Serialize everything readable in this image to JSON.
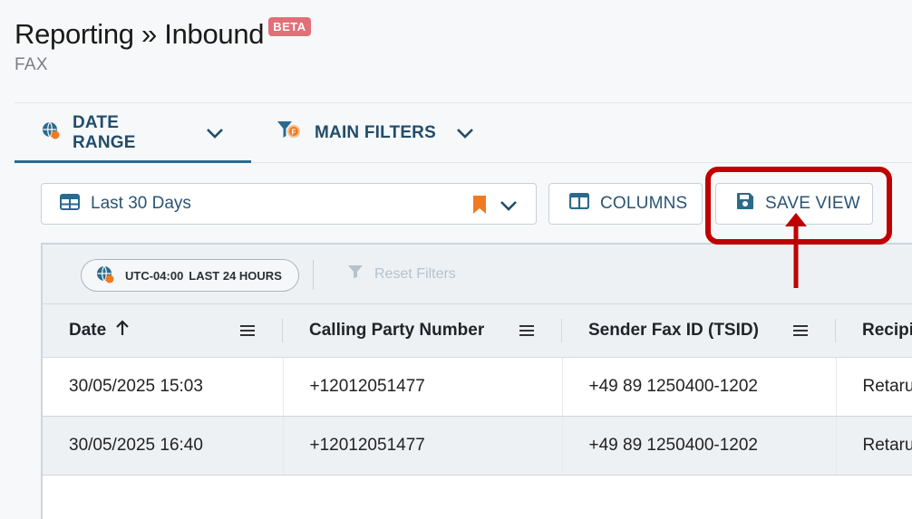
{
  "header": {
    "title": "Reporting » Inbound",
    "badge": "BETA",
    "subtitle": "FAX"
  },
  "tabs": [
    {
      "label": "DATE RANGE",
      "icon": "globe-clock-icon",
      "active": true
    },
    {
      "label": "MAIN FILTERS",
      "icon": "filter-icon",
      "active": false
    }
  ],
  "toolbar": {
    "range_label": "Last 30 Days",
    "columns_label": "COLUMNS",
    "save_view_label": "SAVE VIEW"
  },
  "grid": {
    "timezone": "UTC-04:00",
    "time_range": "LAST 24 HOURS",
    "reset_filters": "Reset Filters",
    "columns": [
      "Date",
      "Calling Party Number",
      "Sender Fax ID (TSID)",
      "Recipi"
    ],
    "rows": [
      [
        "30/05/2025 15:03",
        "+12012051477",
        "+49 89 1250400-1202",
        "Retaru"
      ],
      [
        "30/05/2025 16:40",
        "+12012051477",
        "+49 89 1250400-1202",
        "Retaru"
      ]
    ]
  },
  "colors": {
    "accent": "#204d6b",
    "badge": "#e26f78",
    "highlight": "#c00000",
    "bookmark": "#f07a22"
  }
}
